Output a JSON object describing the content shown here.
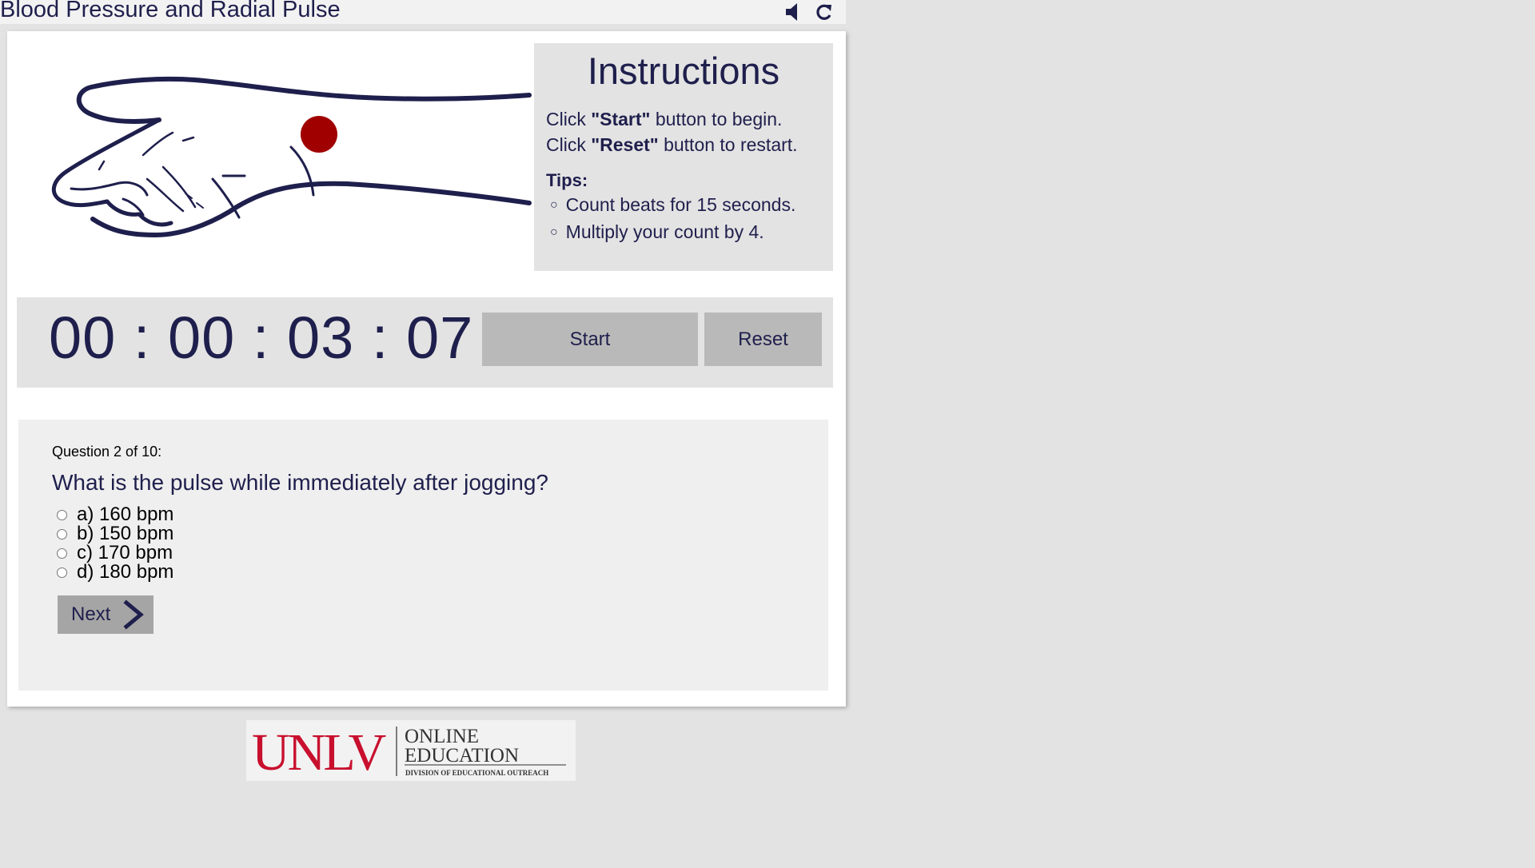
{
  "app": {
    "title": "Blood Pressure and Radial Pulse",
    "icons": [
      "speaker-icon",
      "refresh-icon"
    ]
  },
  "instructions": {
    "heading": "Instructions",
    "line1_pre": "Click ",
    "line1_bold": "\"Start\"",
    "line1_post": " button to begin.",
    "line2_pre": "Click ",
    "line2_bold": "\"Reset\"",
    "line2_post": " button to restart.",
    "tips_label": "Tips:",
    "tips": [
      "Count beats for 15 seconds.",
      "Multiply your count by 4."
    ]
  },
  "timer": {
    "display": "00 : 00 : 03 : 07",
    "start_label": "Start",
    "reset_label": "Reset"
  },
  "quiz": {
    "counter": "Question 2 of 10:",
    "question": "What is the pulse while immediately after jogging?",
    "options": [
      "a) 160 bpm",
      "b) 150 bpm",
      "c) 170 bpm",
      "d) 180 bpm"
    ],
    "next_label": "Next"
  },
  "logo": {
    "brand": "UNLV",
    "line1": "ONLINE",
    "line2": "EDUCATION",
    "line3": "DIVISION OF EDUCATIONAL OUTREACH"
  },
  "colors": {
    "text_navy": "#1f1f4d",
    "pulse_dot": "#a00000",
    "button_gray": "#b9b9b9",
    "panel_gray": "#e3e3e3",
    "unlv_red": "#c8102e"
  }
}
